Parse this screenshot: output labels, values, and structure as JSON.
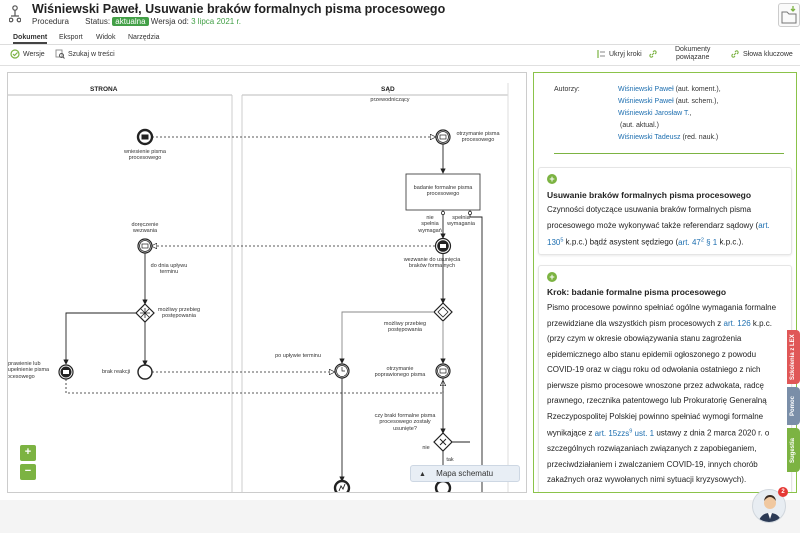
{
  "header": {
    "title": "Wiśniewski Paweł, Usuwanie braków formalnych pisma procesowego",
    "type": "Procedura",
    "status_label": "Status:",
    "status": "aktualna",
    "version_label": "Wersja od:",
    "version_date": "3 lipca 2021 r."
  },
  "tabs": [
    "Dokument",
    "Eksport",
    "Widok",
    "Narzędzia"
  ],
  "toolbar": {
    "versions": "Wersje",
    "search": "Szukaj w treści",
    "hide_steps": "Ukryj kroki",
    "related_docs_1": "Dokumenty",
    "related_docs_2": "powiązane",
    "keywords": "Słowa kluczowe"
  },
  "diagram": {
    "lane_left": "STRONA",
    "lane_right": "SĄD",
    "lane_right_sub": "przewodniczący",
    "labels": {
      "wniesienie": "wniesienie pisma procesowego",
      "otrzymanie": "otrzymanie pisma procesowego",
      "badanie": "badanie formalne pisma procesowego",
      "nie_spelnia": "nie spełnia wymagań",
      "spelnia": "spełnia wymagania",
      "doreczenie": "doręczenie wezwania",
      "wezwanie": "wezwanie do usunięcia braków formalnych",
      "do_dnia": "do dnia upływu terminu",
      "mozliwy_lewy": "możliwy przebieg postępowania",
      "mozliwy_prawy": "możliwy przebieg postępowania",
      "poprawienie": "poprawienie lub uzupełnienie pisma procesowego",
      "brak_reakcji": "brak reakcji",
      "po_uplywie": "po upływie terminu",
      "otrzymanie_popr": "otrzymanie poprawionego pisma",
      "czy_braki": "czy braki formalne pisma procesowego zostały usunięte?",
      "nie": "nie",
      "tak": "tak"
    },
    "zoom_in": "+",
    "zoom_out": "−",
    "map_button": "Mapa schematu"
  },
  "authors": {
    "label": "Autorzy:",
    "list": [
      {
        "name": "Wiśniewski Paweł",
        "role": "(aut. koment.),"
      },
      {
        "name": "Wiśniewski Paweł",
        "role": "(aut. schem.),"
      },
      {
        "name": "Wiśniewski Jarosław T.",
        "role": ","
      },
      {
        "name": "",
        "role": "(aut. aktual.)"
      },
      {
        "name": "Wiśniewski Tadeusz",
        "role": "(red. nauk.)"
      }
    ]
  },
  "card1": {
    "title": "Usuwanie braków formalnych pisma procesowego",
    "text_a": "Czynności dotyczące usuwania braków formalnych pisma procesowego może wykonywać także referendarz sądowy (",
    "link_a": "art. 130",
    "sup_a": "5",
    "text_b": " k.p.c.) bądź asystent sędziego (",
    "link_b": "art. 47",
    "sup_b": "2",
    "link_b2": " § 1",
    "text_c": " k.p.c.)."
  },
  "card2": {
    "title": "Krok: badanie formalne pisma procesowego",
    "text_a": "Pismo procesowe powinno spełniać ogólne wymagania formalne przewidziane dla wszystkich pism procesowych z ",
    "link_a": "art. 126",
    "text_b": " k.p.c. (przy czym w okresie obowiązywania stanu zagrożenia epidemicznego albo stanu epidemii ogłoszonego z powodu COVID-19 oraz w ciągu roku od odwołania ostatniego z nich pierwsze pismo procesowe wnoszone przez adwokata, radcę prawnego, rzecznika patentowego lub Prokuratorię Generalną Rzeczypospolitej Polskiej powinno spełniać wymogi formalne wynikające z ",
    "link_b": "art. 15zzs",
    "sup_b": "9",
    "link_b2": " ust. 1",
    "text_c": " ustawy z dnia 2 marca 2020 r. o szczególnych rozwiązaniach związanych z zapobieganiem, przeciwdziałaniem i zwalczaniem COVID-19, innych chorób zakaźnych oraz wywołanych nimi sytuacji kryzysowych)."
  },
  "side_tabs": {
    "szkolenia": "Szkolenia z LEX",
    "pomoc": "Pomoc",
    "sugestia": "Sugestia"
  },
  "notification_count": "2",
  "colors": {
    "accent_green": "#7cb342",
    "link_blue": "#1e6fb0",
    "side_red": "#e05757",
    "side_blue": "#7a8ea8",
    "side_green": "#7cb342"
  }
}
